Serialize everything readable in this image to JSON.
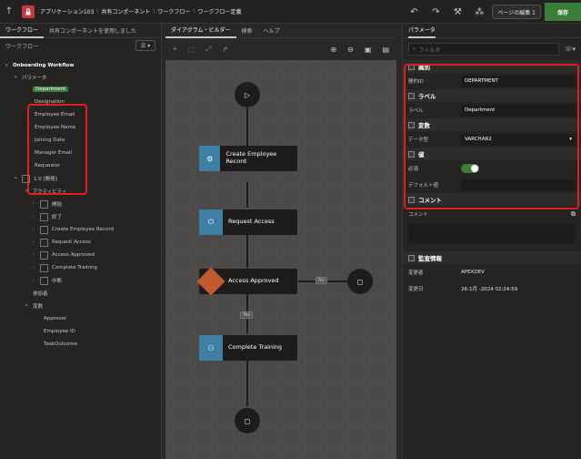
{
  "topbar": {
    "crumbs": [
      "アプリケーション103",
      "共有コンポーネント",
      "ワークフロー",
      "ワークフロー定義"
    ],
    "page_edit_label": "ページの編集 1",
    "save_label": "保存"
  },
  "left": {
    "tabs": [
      "ワークフロー",
      "共有コンポーネントを使用しました"
    ],
    "subheader": "ワークフロー",
    "tree_root": "Onboarding Workflow",
    "params_label": "パラメータ",
    "params": [
      "Department",
      "Designation",
      "Employee Email",
      "Employee Name",
      "Joining Date",
      "Manager Email",
      "Requestor"
    ],
    "version": "1.0 [開発]",
    "activities_label": "アクティビティ",
    "activities": [
      "開始",
      "終了",
      "Create Employee Record",
      "Request Access",
      "Access Approved",
      "Complete Training",
      "中断"
    ],
    "participants_label": "参加者",
    "variables_label": "変数",
    "variables": [
      "Approver",
      "Employee ID",
      "TaskOutcome"
    ]
  },
  "center": {
    "tabs": [
      "ダイアグラム・ビルダー",
      "検索",
      "ヘルプ"
    ],
    "nodes": {
      "create": "Create Employee Record",
      "request": "Request Access",
      "approved": "Access Approved",
      "training": "Complete Training"
    },
    "edge_no": "No",
    "edge_yes": "Yes"
  },
  "right": {
    "tab": "パラメータ",
    "filter_placeholder": "フィルタ",
    "sec_ident": "識別",
    "static_id_label": "静的ID",
    "static_id_value": "DEPARTMENT",
    "sec_label": "ラベル",
    "label_label": "ラベル",
    "label_value": "Department",
    "sec_var": "変数",
    "datatype_label": "データ型",
    "datatype_value": "VARCHAR2",
    "sec_value": "値",
    "required_label": "必須",
    "default_label": "デフォルト値",
    "sec_comment": "コメント",
    "comment_label": "コメント",
    "sec_audit": "監査情報",
    "changed_by_label": "変更者",
    "changed_by_value": "APEXDEV",
    "changed_on_label": "変更日",
    "changed_on_value": "26-1月 -2024 02:24:59"
  }
}
